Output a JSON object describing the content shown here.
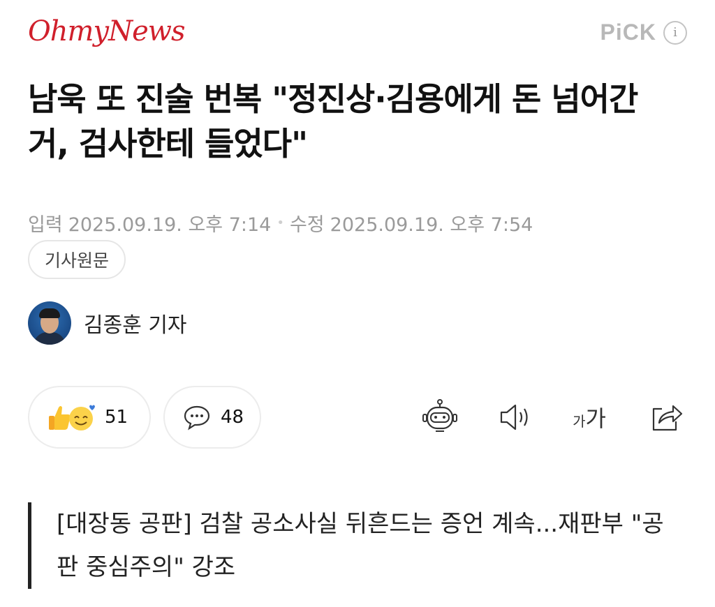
{
  "header": {
    "logo_text": "OhmyNews",
    "pick_label": "PiCK",
    "info_icon": "info-icon",
    "logo_color": "#d01f2b"
  },
  "article": {
    "title": "남욱 또 진술 번복 \"정진상·김용에게 돈 넘어간 거, 검사한테 들었다\"",
    "input_label": "입력",
    "input_date": "2025.09.19. 오후 7:14",
    "edit_label": "수정",
    "edit_date": "2025.09.19. 오후 7:54",
    "original_button": "기사원문",
    "author": "김종훈 기자",
    "subtitle": "[대장동 공판] 검찰 공소사실 뒤흔드는 증언 계속...재판부 \"공판 중심주의\" 강조"
  },
  "actions": {
    "reaction_count": "51",
    "comment_count": "48",
    "fontsize_small": "가",
    "fontsize_big": "가",
    "icons": [
      "thumbs-up-icon",
      "smile-icon",
      "comment-icon",
      "robot-summary-icon",
      "speaker-icon",
      "font-size-icon",
      "share-icon"
    ]
  }
}
